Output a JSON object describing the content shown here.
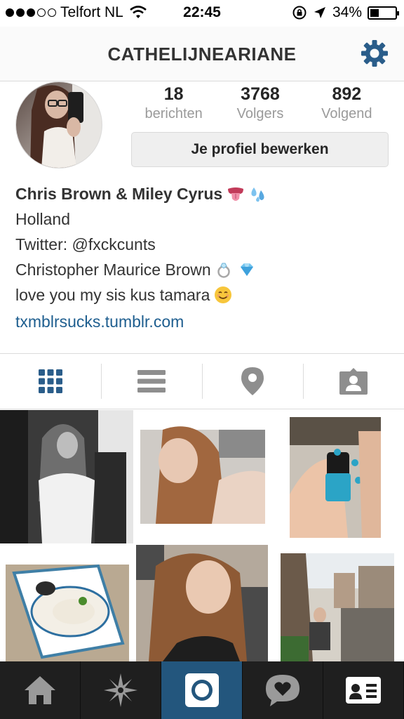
{
  "status_bar": {
    "carrier": "Telfort NL",
    "time": "22:45",
    "battery": "34%",
    "battery_level": 0.34,
    "signal_bars": 3,
    "signal_total": 5
  },
  "header": {
    "username": "CATHELIJNEARIANE",
    "settings_icon": "gear-icon"
  },
  "profile": {
    "stats": [
      {
        "value": "18",
        "label": "berichten"
      },
      {
        "value": "3768",
        "label": "Volgers"
      },
      {
        "value": "892",
        "label": "Volgend"
      }
    ],
    "edit_button": "Je profiel bewerken"
  },
  "bio": {
    "name": "Chris Brown & Miley Cyrus",
    "lines": [
      "Holland",
      "Twitter: @fxckcunts",
      "Christopher Maurice Brown",
      "love you my sis kus tamara"
    ],
    "link": "txmblrsucks.tumblr.com"
  },
  "view_tabs": [
    "grid-icon",
    "list-icon",
    "location-pin-icon",
    "tagged-person-icon"
  ],
  "bottom_tabs": [
    "home-icon",
    "explore-star-icon",
    "camera-icon",
    "activity-heart-bubble-icon",
    "profile-card-icon"
  ],
  "colors": {
    "accent": "#23567d",
    "link": "#1e5e8f",
    "active_tab_icon": "#2a5d8a"
  }
}
